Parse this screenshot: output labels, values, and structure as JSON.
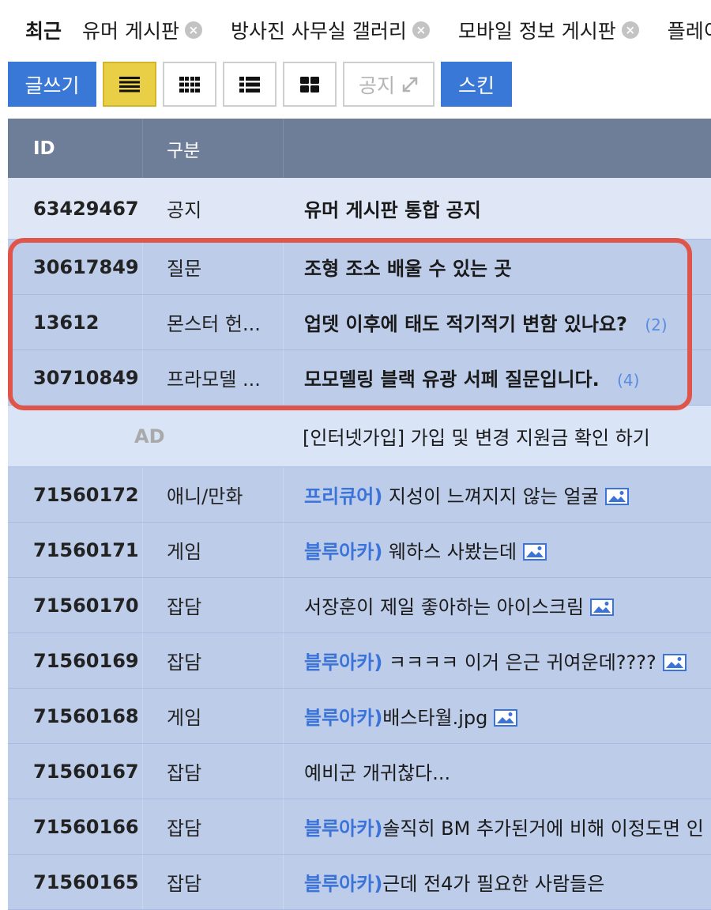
{
  "recent": {
    "label": "최근",
    "tabs": [
      {
        "label": "유머 게시판",
        "close": "×"
      },
      {
        "label": "방사진 사무실 갤러리",
        "close": "×"
      },
      {
        "label": "모바일 정보 게시판",
        "close": "×"
      },
      {
        "label": "플레이"
      }
    ]
  },
  "toolbar": {
    "write_label": "글쓰기",
    "notice_label": "공지",
    "notice_icon": "expand-arrows-icon",
    "skin_label": "스킨",
    "views": [
      {
        "icon": "list-view-icon",
        "active": true
      },
      {
        "icon": "grid-small-view-icon",
        "active": false
      },
      {
        "icon": "list-thumb-view-icon",
        "active": false
      },
      {
        "icon": "grid-large-view-icon",
        "active": false
      }
    ]
  },
  "board": {
    "header": {
      "id": "ID",
      "category": "구분",
      "title": ""
    },
    "notice": {
      "id": "63429467",
      "category": "공지",
      "title": "유머 게시판 통합 공지"
    },
    "highlighted": [
      {
        "id": "30617849",
        "category": "질문",
        "title": "조형 조소 배울 수 있는 곳",
        "count": ""
      },
      {
        "id": "13612",
        "category": "몬스터 헌...",
        "title": "업뎃 이후에 태도 적기적기 변함 있나요?",
        "count": "(2)"
      },
      {
        "id": "30710849",
        "category": "프라모델 ...",
        "title": "모모델링 블랙 유광 서페 질문입니다.",
        "count": "(4)"
      }
    ],
    "ad": {
      "label": "AD",
      "title": "[인터넷가입] 가입 및 변경 지원금 확인 하기"
    },
    "posts": [
      {
        "id": "71560172",
        "category": "애니/만화",
        "prefix": "프리큐어)",
        "title": " 지성이 느껴지지 않는 얼굴",
        "image": true
      },
      {
        "id": "71560171",
        "category": "게임",
        "prefix": "블루아카)",
        "title": " 웨하스 사봤는데",
        "image": true
      },
      {
        "id": "71560170",
        "category": "잡담",
        "prefix": "",
        "title": "서장훈이 제일 좋아하는 아이스크림",
        "image": true
      },
      {
        "id": "71560169",
        "category": "잡담",
        "prefix": "블루아카)",
        "title": " ㅋㅋㅋㅋ 이거 은근 귀여운데????",
        "image": true
      },
      {
        "id": "71560168",
        "category": "게임",
        "prefix": "블루아카)",
        "title": "배스타월.jpg",
        "image": true
      },
      {
        "id": "71560167",
        "category": "잡담",
        "prefix": "",
        "title": "예비군 개귀찮다...",
        "image": false
      },
      {
        "id": "71560166",
        "category": "잡담",
        "prefix": "블루아카)",
        "title": "솔직히 BM 추가된거에 비해 이정도면 인",
        "image": false
      },
      {
        "id": "71560165",
        "category": "잡담",
        "prefix": "블루아카)",
        "title": "근데 전4가 필요한 사람들은",
        "image": false
      }
    ]
  },
  "colors": {
    "accent_blue": "#3a78d8",
    "header_bg": "#6f7e98",
    "row_bg": "#bccce9",
    "highlight_border": "#e0554a",
    "prefix_blue": "#3b73d9"
  }
}
